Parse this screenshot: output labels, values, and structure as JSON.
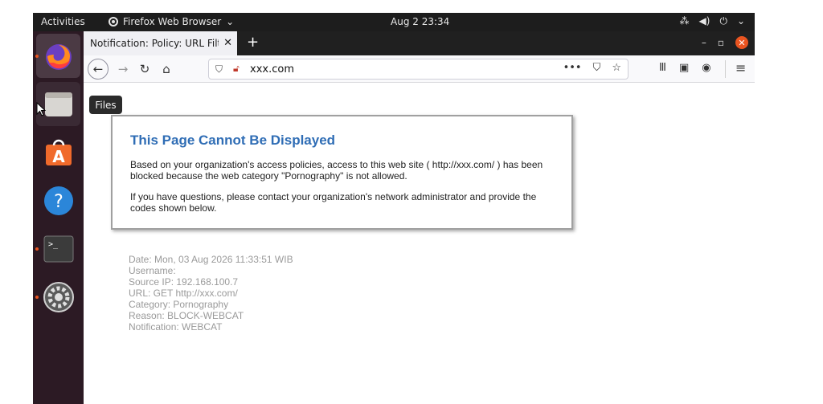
{
  "topbar": {
    "activities": "Activities",
    "app_name": "Firefox Web Browser",
    "clock": "Aug 2  23:34"
  },
  "dock": {
    "items": [
      "firefox",
      "files",
      "software-center",
      "help",
      "terminal",
      "settings"
    ],
    "tooltip": "Files"
  },
  "browser": {
    "tab_title": "Notification: Policy: URL Filt",
    "url": "xxx.com"
  },
  "page": {
    "title": "This Page Cannot Be Displayed",
    "para1": "Based on your organization's access policies, access to this web site ( http://xxx.com/ ) has been blocked because the web category \"Pornography\" is not allowed.",
    "para2": "If you have questions, please contact your organization's network administrator and provide the codes shown below.",
    "details": [
      "Date: Mon, 03 Aug 2026 11:33:51 WIB",
      "Username:",
      "Source IP: 192.168.100.7",
      "URL: GET http://xxx.com/",
      "Category: Pornography",
      "Reason: BLOCK-WEBCAT",
      "Notification: WEBCAT"
    ]
  },
  "colors": {
    "accent": "#e95420",
    "title_blue": "#2f6db5",
    "dock_bg": "#2c1a24"
  }
}
